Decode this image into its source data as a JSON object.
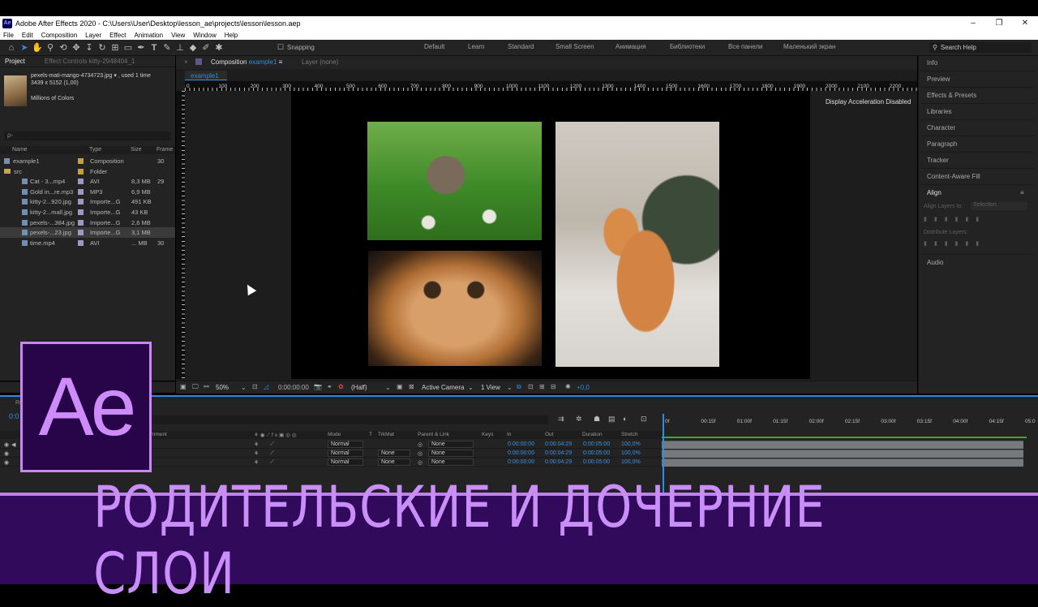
{
  "window": {
    "app_icon": "Ae",
    "title": "Adobe After Effects 2020 - C:\\Users\\User\\Desktop\\lesson_ae\\projects\\lesson\\lesson.aep",
    "controls": [
      "–",
      "❐",
      "✕"
    ]
  },
  "menu": [
    "File",
    "Edit",
    "Composition",
    "Layer",
    "Effect",
    "Animation",
    "View",
    "Window",
    "Help"
  ],
  "toolbar": {
    "snapping": "Snapping",
    "workspaces": [
      "Default",
      "Learn",
      "Standard",
      "Small Screen",
      "Анимация",
      "Библиотеки",
      "Все панели",
      "Маленький экран"
    ],
    "search_help": "Search Help"
  },
  "project_panel": {
    "tab_project": "Project",
    "tab_effects": "Effect Controls  kitty-2948404_1",
    "selected_file": {
      "name": "pexels-mati-mango-4734723.jpg",
      "used": ", used 1 time",
      "dims": "3439 x 5152 (1,00)",
      "colors": "Millions of Colors"
    },
    "search_placeholder": "ρ-",
    "columns": [
      "Name",
      "Type",
      "Size",
      "Frame"
    ],
    "items": [
      {
        "name": "example1",
        "type": "Composition",
        "size": "",
        "frame": "30",
        "label_color": "#c4a13a",
        "indent": 0
      },
      {
        "name": "src",
        "type": "Folder",
        "size": "",
        "frame": "",
        "label_color": "#c4a13a",
        "indent": 0
      },
      {
        "name": "Cat - 3...mp4",
        "type": "AVI",
        "size": "8,3 MB",
        "frame": "29",
        "label_color": "#9c9ac2",
        "indent": 1
      },
      {
        "name": "Gold in...re.mp3",
        "type": "MP3",
        "size": "6,9 MB",
        "frame": "",
        "label_color": "#9c9ac2",
        "indent": 1
      },
      {
        "name": "kitty-2...920.jpg",
        "type": "Importe...G",
        "size": "491 KB",
        "frame": "",
        "label_color": "#9c9ac2",
        "indent": 1
      },
      {
        "name": "kitty-2...mall.jpg",
        "type": "Importe...G",
        "size": "43 KB",
        "frame": "",
        "label_color": "#9c9ac2",
        "indent": 1
      },
      {
        "name": "pexels-...384.jpg",
        "type": "Importe...G",
        "size": "2,6 MB",
        "frame": "",
        "label_color": "#9c9ac2",
        "indent": 1
      },
      {
        "name": "pexels-...23.jpg",
        "type": "Importe...G",
        "size": "3,1 MB",
        "frame": "",
        "label_color": "#9c9ac2",
        "indent": 1
      },
      {
        "name": "time.mp4",
        "type": "AVI",
        "size": "... MB",
        "frame": "30",
        "label_color": "#9c9ac2",
        "indent": 0
      }
    ]
  },
  "composition": {
    "tab_label": "Composition",
    "tab_name": "example1",
    "layer_tab": "Layer  (none)",
    "subtab": "example1",
    "ruler_labels": [
      "0",
      "100",
      "200",
      "300",
      "400",
      "500",
      "600",
      "700",
      "800",
      "900",
      "1000",
      "1100",
      "1200",
      "1300",
      "1400",
      "1500",
      "1600",
      "1700",
      "1800",
      "1900",
      "2000",
      "2100",
      "2200",
      "230"
    ],
    "accel_notice": "Display Acceleration Disabled"
  },
  "viewer_bar": {
    "zoom": "50%",
    "timecode": "0:00:00:00",
    "resolution": "(Half)",
    "camera": "Active Camera",
    "views": "1 View",
    "exposure": "+0,0"
  },
  "right_panel": {
    "items": [
      "Info",
      "Preview",
      "Effects & Presets",
      "Libraries",
      "Character",
      "Paragraph",
      "Tracker",
      "Content-Aware Fill"
    ],
    "align_title": "Align",
    "align_layers_to": "Align Layers to:",
    "align_target": "Selection",
    "distribute": "Distribute Layers:",
    "audio": "Audio"
  },
  "timeline": {
    "timecode": "0:0",
    "tab_prefix": "Re",
    "columns": {
      "comment": "mment",
      "mode": "Mode",
      "t": "T",
      "trkmat": "TrkMat",
      "parent": "Parent & Link",
      "keys": "Keys",
      "in": "In",
      "out": "Out",
      "duration": "Duration",
      "stretch": "Stretch"
    },
    "layers": [
      {
        "mode": "Normal",
        "trkmat": "",
        "parent": "None",
        "in": "0:00:00:00",
        "out": "0:00:04:29",
        "duration": "0:00:05:00",
        "stretch": "100,0%"
      },
      {
        "mode": "Normal",
        "trkmat": "None",
        "parent": "None",
        "in": "0:00:00:00",
        "out": "0:00:04:29",
        "duration": "0:00:05:00",
        "stretch": "100,0%"
      },
      {
        "mode": "Normal",
        "trkmat": "None",
        "parent": "None",
        "in": "0:00:00:00",
        "out": "0:00:04:29",
        "duration": "0:00:05:00",
        "stretch": "100,0%"
      }
    ],
    "ruler": [
      "0f",
      "00:15f",
      "01:00f",
      "01:15f",
      "02:00f",
      "02:15f",
      "03:00f",
      "03:15f",
      "04:00f",
      "04:15f",
      "05:0"
    ]
  },
  "overlay": {
    "logo_text": "Ae",
    "banner_text": "РОДИТЕЛЬСКИЕ И ДОЧЕРНИЕ СЛОИ",
    "accent": "#c98ef8",
    "banner_bg": "#310a5c"
  }
}
